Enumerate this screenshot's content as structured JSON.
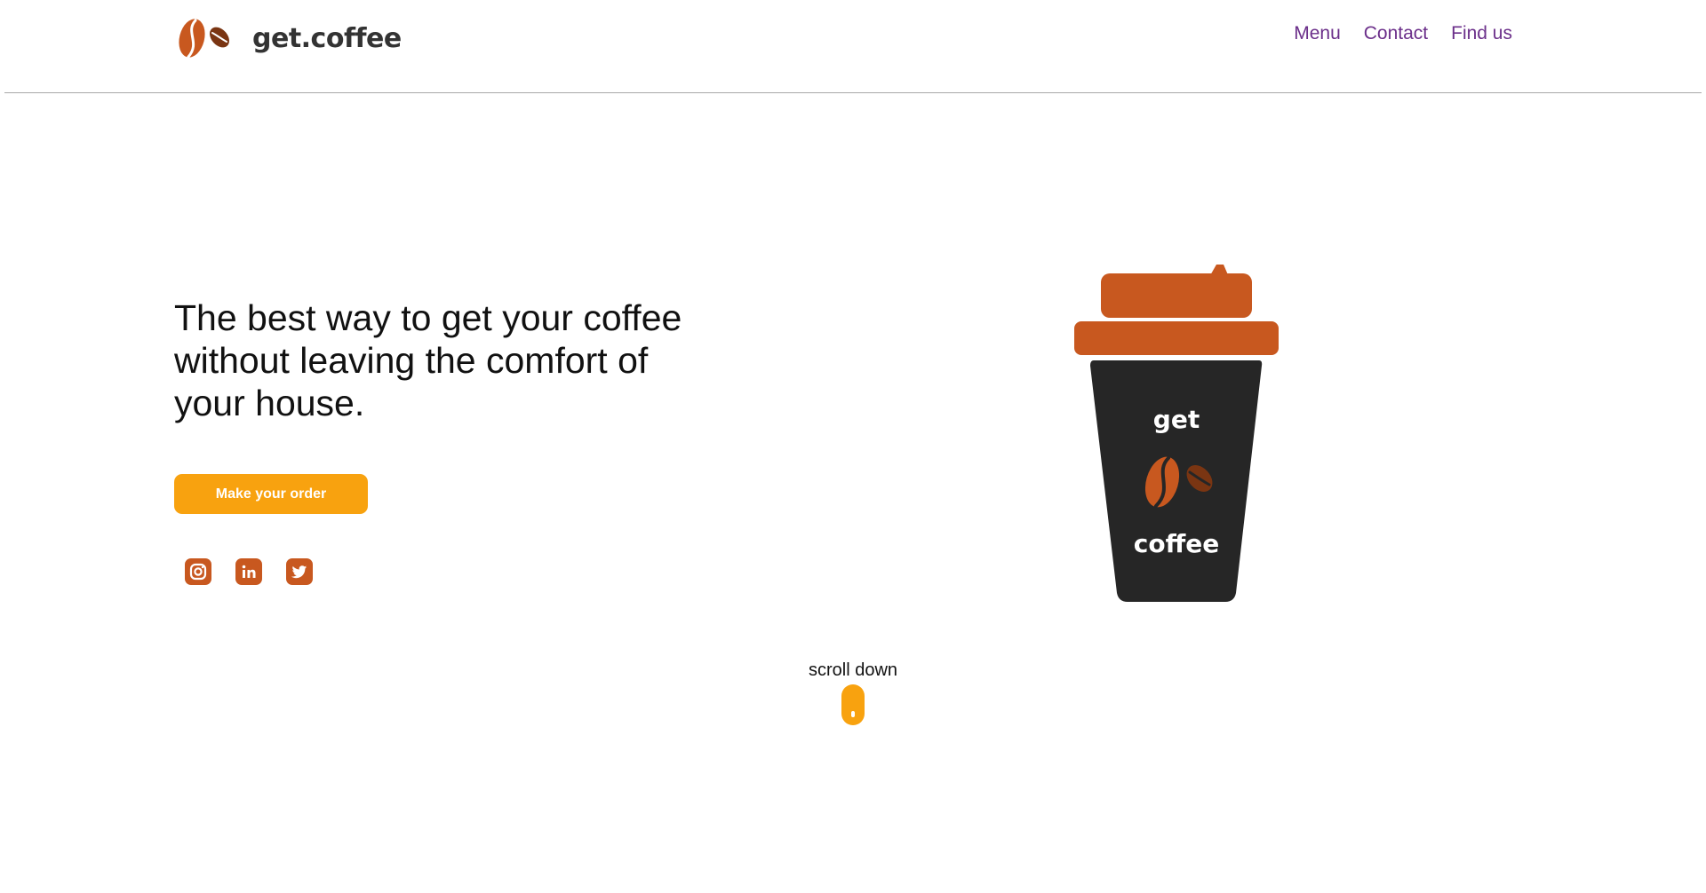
{
  "header": {
    "brand": "get.coffee",
    "nav": [
      {
        "label": "Menu"
      },
      {
        "label": "Contact"
      },
      {
        "label": "Find us"
      }
    ]
  },
  "hero": {
    "headline": "The best way to get your coffee without leaving the comfort of your house.",
    "cta_label": "Make your order",
    "socials": [
      {
        "icon": "instagram-icon"
      },
      {
        "icon": "linkedin-icon"
      },
      {
        "icon": "twitter-icon"
      }
    ]
  },
  "cup": {
    "top_text": "get",
    "bottom_text": "coffee"
  },
  "scroll": {
    "label": "scroll down"
  },
  "colors": {
    "accent": "#f8a20f",
    "brand_orange": "#c8581f",
    "bean_dark": "#7a3512",
    "nav_link": "#6b2f8a",
    "cup_body": "#262626"
  }
}
